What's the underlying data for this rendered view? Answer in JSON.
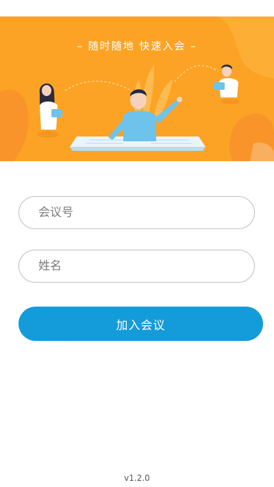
{
  "banner": {
    "slogan": "– 随时随地  快速入会 –"
  },
  "form": {
    "meeting_number": {
      "value": "",
      "placeholder": "会议号"
    },
    "name": {
      "value": "",
      "placeholder": "姓名"
    },
    "join_button_label": "加入会议"
  },
  "footer": {
    "version": "v1.2.0"
  },
  "colors": {
    "banner_orange": "#FCA424",
    "button_blue": "#149BDA",
    "field_border": "#BDBDBD"
  }
}
